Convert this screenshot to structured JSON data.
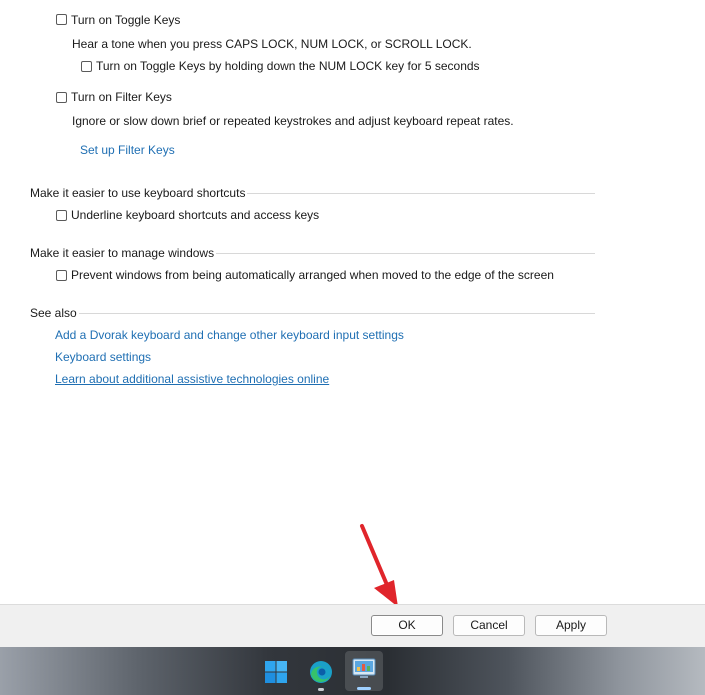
{
  "toggle_keys": {
    "checkbox_label": "Turn on Toggle Keys",
    "description": "Hear a tone when you press CAPS LOCK, NUM LOCK, or SCROLL LOCK.",
    "sub_checkbox_label": "Turn on Toggle Keys by holding down the NUM LOCK key for 5 seconds"
  },
  "filter_keys": {
    "checkbox_label": "Turn on Filter Keys",
    "description": "Ignore or slow down brief or repeated keystrokes and adjust keyboard repeat rates.",
    "setup_link": "Set up Filter Keys"
  },
  "keyboard_shortcuts": {
    "title": "Make it easier to use keyboard shortcuts",
    "checkbox_label": "Underline keyboard shortcuts and access keys"
  },
  "manage_windows": {
    "title": "Make it easier to manage windows",
    "checkbox_label": "Prevent windows from being automatically arranged when moved to the edge of the screen"
  },
  "see_also": {
    "title": "See also",
    "links": [
      "Add a Dvorak keyboard and change other keyboard input settings",
      "Keyboard settings",
      "Learn about additional assistive technologies online"
    ]
  },
  "footer": {
    "ok_label": "OK",
    "cancel_label": "Cancel",
    "apply_label": "Apply"
  },
  "colors": {
    "link": "#1f6fb3",
    "annotation_arrow": "#e0252b",
    "footer_bg": "#f0f0f0"
  },
  "taskbar": {
    "icons": [
      "windows-start-icon",
      "edge-browser-icon",
      "control-panel-icon"
    ]
  }
}
